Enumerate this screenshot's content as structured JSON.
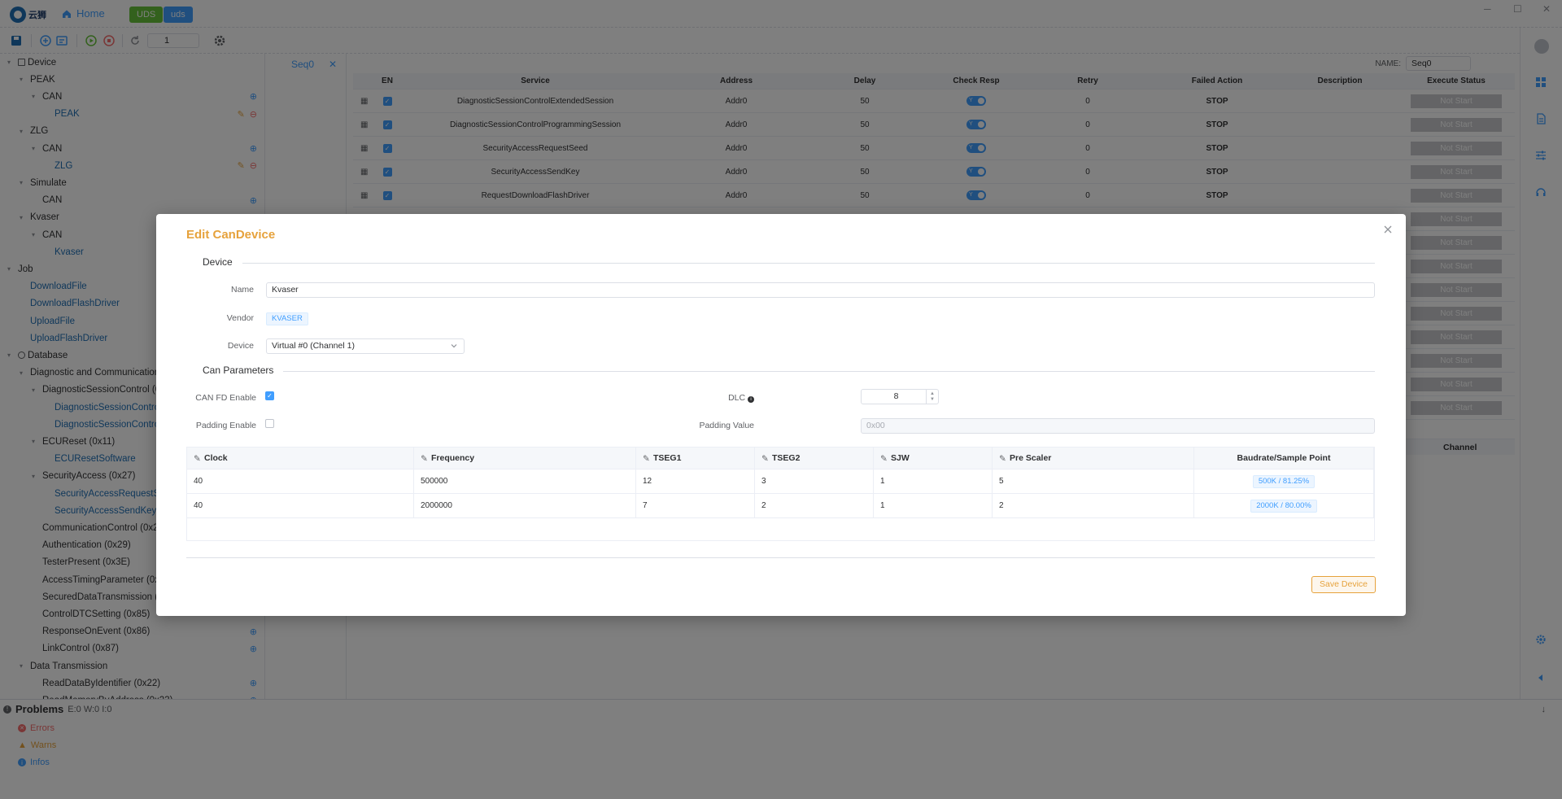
{
  "titlebar": {
    "logo_text": "云狮",
    "home": "Home",
    "tag1": "UDS",
    "tag2": "uds"
  },
  "toolbar": {
    "stepper_value": "1"
  },
  "tree": [
    {
      "depth": 0,
      "caret": "▾",
      "icon": "device",
      "label": "Device",
      "link": false,
      "actions": []
    },
    {
      "depth": 1,
      "caret": "▾",
      "label": "PEAK",
      "link": false,
      "actions": []
    },
    {
      "depth": 2,
      "caret": "▾",
      "label": "CAN",
      "link": false,
      "actions": [
        "add"
      ]
    },
    {
      "depth": 3,
      "caret": "",
      "label": "PEAK",
      "link": true,
      "actions": [
        "edit",
        "remove"
      ]
    },
    {
      "depth": 1,
      "caret": "▾",
      "label": "ZLG",
      "link": false,
      "actions": []
    },
    {
      "depth": 2,
      "caret": "▾",
      "label": "CAN",
      "link": false,
      "actions": [
        "add"
      ]
    },
    {
      "depth": 3,
      "caret": "",
      "label": "ZLG",
      "link": true,
      "actions": [
        "edit",
        "remove"
      ]
    },
    {
      "depth": 1,
      "caret": "▾",
      "label": "Simulate",
      "link": false,
      "actions": []
    },
    {
      "depth": 2,
      "caret": "",
      "label": "CAN",
      "link": false,
      "actions": [
        "add"
      ]
    },
    {
      "depth": 1,
      "caret": "▾",
      "label": "Kvaser",
      "link": false,
      "actions": []
    },
    {
      "depth": 2,
      "caret": "▾",
      "label": "CAN",
      "link": false,
      "actions": []
    },
    {
      "depth": 3,
      "caret": "",
      "label": "Kvaser",
      "link": true,
      "actions": []
    },
    {
      "depth": 0,
      "caret": "▾",
      "label": "Job",
      "link": false,
      "actions": []
    },
    {
      "depth": 1,
      "caret": "",
      "label": "DownloadFile",
      "link": true,
      "actions": []
    },
    {
      "depth": 1,
      "caret": "",
      "label": "DownloadFlashDriver",
      "link": true,
      "actions": []
    },
    {
      "depth": 1,
      "caret": "",
      "label": "UploadFile",
      "link": true,
      "actions": []
    },
    {
      "depth": 1,
      "caret": "",
      "label": "UploadFlashDriver",
      "link": true,
      "actions": []
    },
    {
      "depth": 0,
      "caret": "▾",
      "icon": "database",
      "label": "Database",
      "link": false,
      "actions": []
    },
    {
      "depth": 1,
      "caret": "▾",
      "label": "Diagnostic and Communication Management",
      "link": false,
      "actions": []
    },
    {
      "depth": 2,
      "caret": "▾",
      "label": "DiagnosticSessionControl (0x10)",
      "link": false,
      "actions": []
    },
    {
      "depth": 3,
      "caret": "",
      "label": "DiagnosticSessionControlExtendedSession",
      "link": true,
      "actions": []
    },
    {
      "depth": 3,
      "caret": "",
      "label": "DiagnosticSessionControlProgrammingSession",
      "link": true,
      "actions": []
    },
    {
      "depth": 2,
      "caret": "▾",
      "label": "ECUReset (0x11)",
      "link": false,
      "actions": []
    },
    {
      "depth": 3,
      "caret": "",
      "label": "ECUResetSoftware",
      "link": true,
      "actions": []
    },
    {
      "depth": 2,
      "caret": "▾",
      "label": "SecurityAccess (0x27)",
      "link": false,
      "actions": []
    },
    {
      "depth": 3,
      "caret": "",
      "label": "SecurityAccessRequestSeed",
      "link": true,
      "actions": []
    },
    {
      "depth": 3,
      "caret": "",
      "label": "SecurityAccessSendKey",
      "link": true,
      "actions": []
    },
    {
      "depth": 2,
      "caret": "",
      "label": "CommunicationControl (0x28)",
      "link": false,
      "actions": []
    },
    {
      "depth": 2,
      "caret": "",
      "label": "Authentication (0x29)",
      "link": false,
      "actions": []
    },
    {
      "depth": 2,
      "caret": "",
      "label": "TesterPresent (0x3E)",
      "link": false,
      "actions": []
    },
    {
      "depth": 2,
      "caret": "",
      "label": "AccessTimingParameter (0x83)",
      "link": false,
      "actions": []
    },
    {
      "depth": 2,
      "caret": "",
      "label": "SecuredDataTransmission (0x84)",
      "link": false,
      "actions": []
    },
    {
      "depth": 2,
      "caret": "",
      "label": "ControlDTCSetting (0x85)",
      "link": false,
      "actions": []
    },
    {
      "depth": 2,
      "caret": "",
      "label": "ResponseOnEvent (0x86)",
      "link": false,
      "actions": [
        "add"
      ]
    },
    {
      "depth": 2,
      "caret": "",
      "label": "LinkControl (0x87)",
      "link": false,
      "actions": [
        "add"
      ]
    },
    {
      "depth": 1,
      "caret": "▾",
      "label": "Data Transmission",
      "link": false,
      "actions": []
    },
    {
      "depth": 2,
      "caret": "",
      "label": "ReadDataByIdentifier (0x22)",
      "link": false,
      "actions": [
        "add"
      ]
    },
    {
      "depth": 2,
      "caret": "",
      "label": "ReadMemoryByAddress (0x23)",
      "link": false,
      "actions": [
        "add"
      ]
    }
  ],
  "seq": {
    "tab": "Seq0",
    "name_label": "NAME:",
    "name_value": "Seq0",
    "columns": [
      "EN",
      "Service",
      "Address",
      "Delay",
      "Check Resp",
      "Retry",
      "Failed Action",
      "Description",
      "Execute Status"
    ],
    "rows": [
      {
        "service": "DiagnosticSessionControlExtendedSession",
        "address": "Addr0",
        "delay": "50",
        "retry": "0",
        "failed": "STOP",
        "status": "Not Start"
      },
      {
        "service": "DiagnosticSessionControlProgrammingSession",
        "address": "Addr0",
        "delay": "50",
        "retry": "0",
        "failed": "STOP",
        "status": "Not Start"
      },
      {
        "service": "SecurityAccessRequestSeed",
        "address": "Addr0",
        "delay": "50",
        "retry": "0",
        "failed": "STOP",
        "status": "Not Start"
      },
      {
        "service": "SecurityAccessSendKey",
        "address": "Addr0",
        "delay": "50",
        "retry": "0",
        "failed": "STOP",
        "status": "Not Start"
      },
      {
        "service": "RequestDownloadFlashDriver",
        "address": "Addr0",
        "delay": "50",
        "retry": "0",
        "failed": "STOP",
        "status": "Not Start"
      },
      {
        "service": "",
        "address": "",
        "delay": "",
        "retry": "",
        "failed": "",
        "status": "Not Start"
      },
      {
        "service": "",
        "address": "",
        "delay": "",
        "retry": "",
        "failed": "",
        "status": "Not Start"
      },
      {
        "service": "",
        "address": "",
        "delay": "",
        "retry": "",
        "failed": "",
        "status": "Not Start"
      },
      {
        "service": "",
        "address": "",
        "delay": "",
        "retry": "",
        "failed": "",
        "status": "Not Start"
      },
      {
        "service": "",
        "address": "",
        "delay": "",
        "retry": "",
        "failed": "",
        "status": "Not Start"
      },
      {
        "service": "",
        "address": "",
        "delay": "",
        "retry": "",
        "failed": "",
        "status": "Not Start"
      },
      {
        "service": "",
        "address": "",
        "delay": "",
        "retry": "",
        "failed": "",
        "status": "Not Start"
      },
      {
        "service": "",
        "address": "",
        "delay": "",
        "retry": "",
        "failed": "",
        "status": "Not Start"
      },
      {
        "service": "",
        "address": "",
        "delay": "",
        "retry": "",
        "failed": "",
        "status": "Not Start"
      }
    ],
    "lower_header": "Channel"
  },
  "problems": {
    "title": "Problems",
    "counts": "E:0 W:0 I:0",
    "errors": "Errors",
    "warns": "Warns",
    "infos": "Infos"
  },
  "dialog": {
    "title": "Edit CanDevice",
    "section_device": "Device",
    "name_label": "Name",
    "name_value": "Kvaser",
    "vendor_label": "Vendor",
    "vendor_value": "KVASER",
    "device_label": "Device",
    "device_value": "Virtual #0 (Channel 1)",
    "section_can": "Can Parameters",
    "canfd_label": "CAN FD Enable",
    "canfd_checked": true,
    "dlc_label": "DLC",
    "dlc_value": "8",
    "padding_label": "Padding Enable",
    "padding_checked": false,
    "padding_value_label": "Padding Value",
    "padding_value_placeholder": "0x00",
    "columns": [
      "Clock",
      "Frequency",
      "TSEG1",
      "TSEG2",
      "SJW",
      "Pre Scaler",
      "Baudrate/Sample Point"
    ],
    "rows": [
      {
        "clock": "40",
        "frequency": "500000",
        "tseg1": "12",
        "tseg2": "3",
        "sjw": "1",
        "prescaler": "5",
        "baud": "500K / 81.25%"
      },
      {
        "clock": "40",
        "frequency": "2000000",
        "tseg1": "7",
        "tseg2": "2",
        "sjw": "1",
        "prescaler": "2",
        "baud": "2000K / 80.00%"
      }
    ],
    "save_label": "Save Device"
  }
}
